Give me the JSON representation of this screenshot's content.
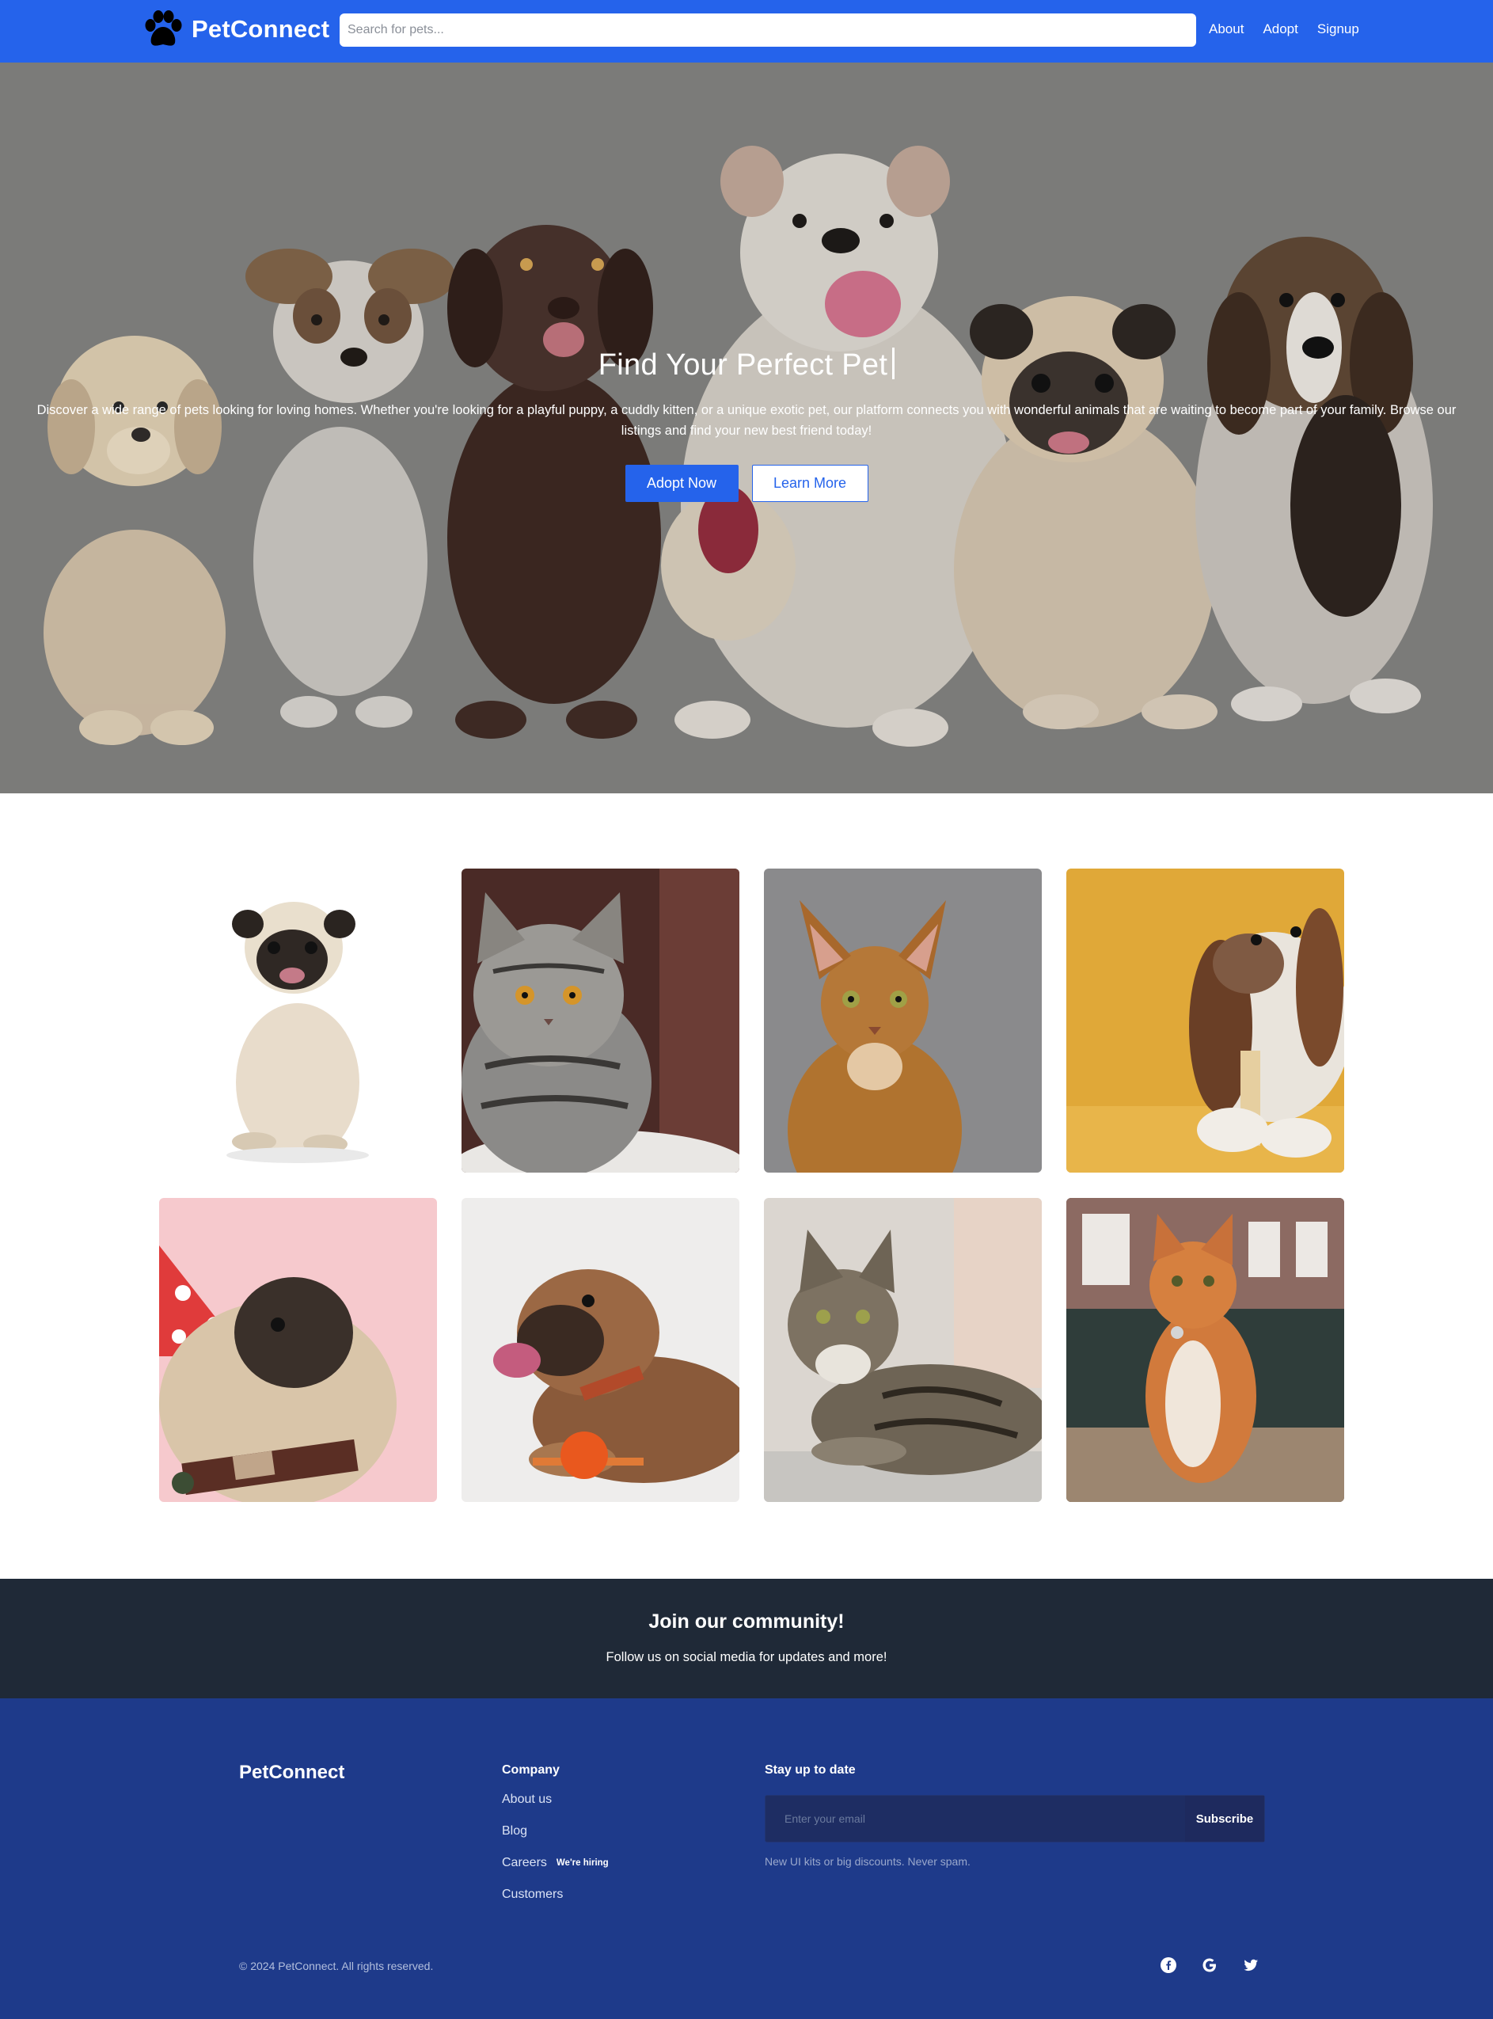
{
  "nav": {
    "brand": "PetConnect",
    "search_placeholder": "Search for pets...",
    "links": [
      "About",
      "Adopt",
      "Signup"
    ]
  },
  "hero": {
    "title": "Find Your Perfect Pet",
    "description": "Discover a wide range of pets looking for loving homes. Whether you're looking for a playful puppy, a cuddly kitten, or a unique exotic pet, our platform connects you with wonderful animals that are waiting to become part of your family. Browse our listings and find your new best friend today!",
    "primary_button": "Adopt Now",
    "secondary_button": "Learn More"
  },
  "gallery": {
    "items": [
      {
        "name": "pug-sitting"
      },
      {
        "name": "tabby-cat-gray"
      },
      {
        "name": "abyssinian-cat"
      },
      {
        "name": "basset-hound"
      },
      {
        "name": "pug-party-hat"
      },
      {
        "name": "bulldog-with-ball"
      },
      {
        "name": "tabby-cat-lying"
      },
      {
        "name": "orange-cat"
      }
    ]
  },
  "community": {
    "title": "Join our community!",
    "subtitle": "Follow us on social media for updates and more!"
  },
  "footer": {
    "brand": "PetConnect",
    "company_title": "Company",
    "company_links": [
      "About us",
      "Blog",
      "Careers",
      "Customers"
    ],
    "hiring_badge": "We're hiring",
    "newsletter_title": "Stay up to date",
    "email_placeholder": "Enter your email",
    "subscribe_label": "Subscribe",
    "newsletter_note": "New UI kits or big discounts. Never spam.",
    "copyright": "© 2024 PetConnect. All rights reserved.",
    "social_icons": [
      "facebook-icon",
      "google-icon",
      "twitter-icon"
    ]
  },
  "colors": {
    "primary": "#2563eb",
    "community_bg": "#1f2937",
    "footer_bg": "#1e3a8a"
  }
}
